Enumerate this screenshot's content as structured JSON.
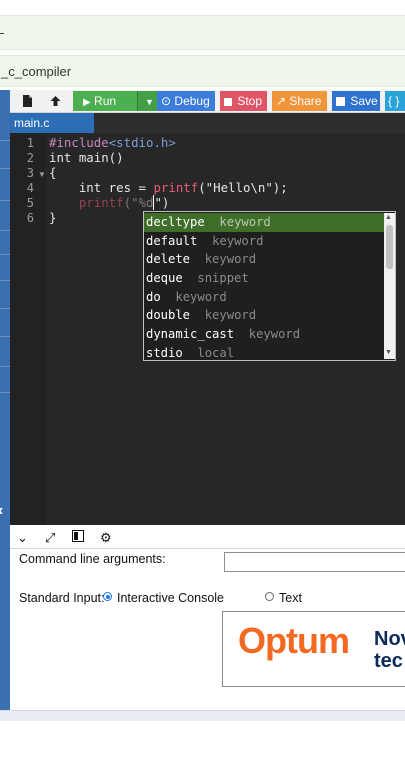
{
  "browser": {
    "page_title_fragment": "_c_compiler"
  },
  "toolbar": {
    "run_label": "Run",
    "debug_label": "Debug",
    "stop_label": "Stop",
    "share_label": "Share",
    "save_label": "Save",
    "beautify_label": "{ }",
    "colors": {
      "run": "#4caf50",
      "debug": "#3c7ddb",
      "stop": "#e05566",
      "share": "#f0953a",
      "save": "#2f73d1",
      "beautify": "#29a3d9"
    }
  },
  "editor": {
    "tab_label": "main.c",
    "line_numbers": [
      "1",
      "2",
      "3",
      "4",
      "5",
      "6"
    ],
    "lines": {
      "l1_include": "#include",
      "l1_header": "<stdio.h>",
      "l2": "int main()",
      "l3": "{",
      "l4_pre": "    int res = ",
      "l4_fn": "printf",
      "l4_post": "(\"Hello\\n\");",
      "l5_pre": "    ",
      "l5_fn": "printf",
      "l5_mid": "(\"%",
      "l5_typed": "d",
      "l5_post": "\")",
      "l6": "}"
    }
  },
  "autocomplete": {
    "items": [
      {
        "word": "decltype",
        "kind": "keyword",
        "selected": true
      },
      {
        "word": "default",
        "kind": "keyword",
        "selected": false
      },
      {
        "word": "delete",
        "kind": "keyword",
        "selected": false
      },
      {
        "word": "deque",
        "kind": "snippet",
        "selected": false
      },
      {
        "word": "do",
        "kind": "keyword",
        "selected": false
      },
      {
        "word": "double",
        "kind": "keyword",
        "selected": false
      },
      {
        "word": "dynamic_cast",
        "kind": "keyword",
        "selected": false
      },
      {
        "word": "stdio",
        "kind": "local",
        "selected": false
      }
    ]
  },
  "io_panel": {
    "cmd_args_label": "Command line arguments:",
    "cmd_args_value": "",
    "stdin_label": "Standard Input:",
    "stdin_options": {
      "interactive": "Interactive Console",
      "text": "Text"
    },
    "selected_option": "interactive"
  },
  "ad": {
    "brand": "Optum",
    "line1": "Nov",
    "line2": "tec"
  },
  "icons": [
    "file-icon",
    "upload-icon",
    "play-icon",
    "caret-down-icon",
    "debug-icon",
    "stop-icon",
    "share-icon",
    "save-icon",
    "chevron-down-icon",
    "expand-icon",
    "panel-icon",
    "gear-icon"
  ]
}
